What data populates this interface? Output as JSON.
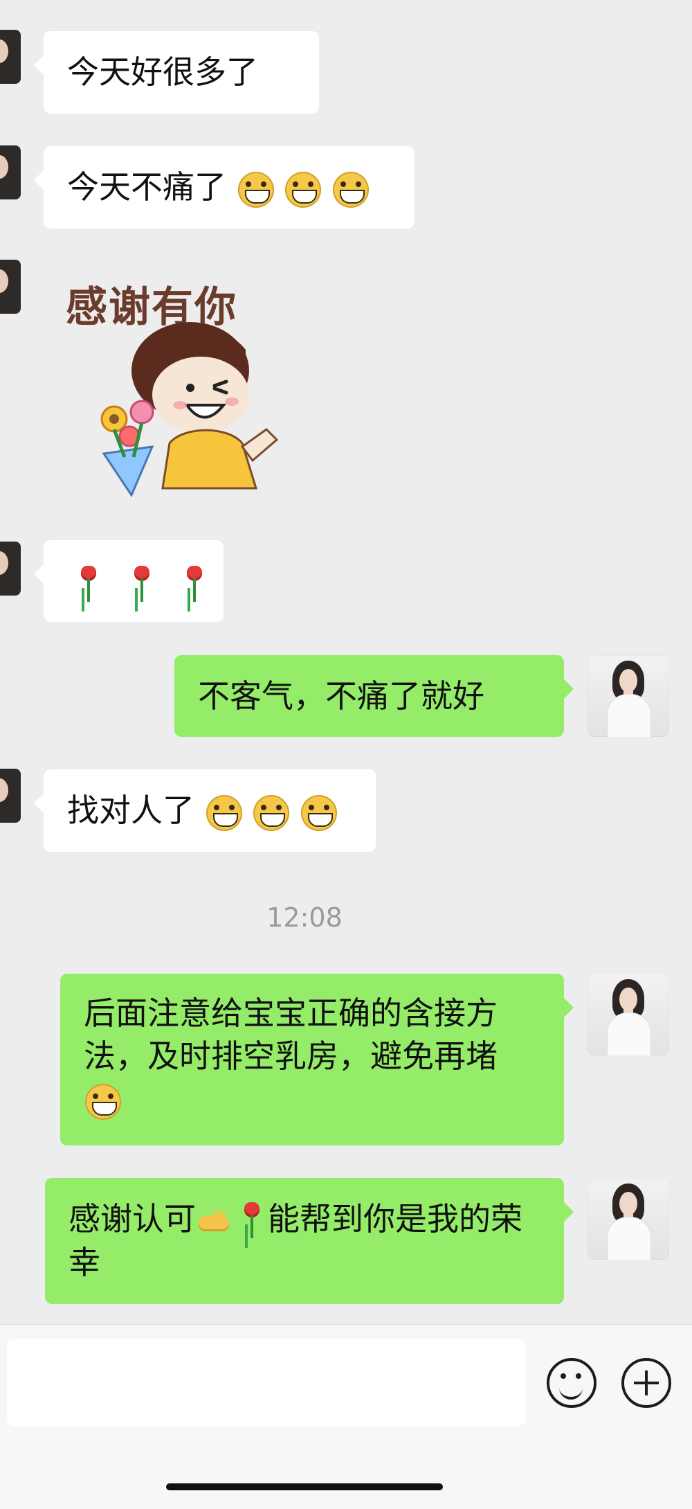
{
  "messages": [
    {
      "side": "in",
      "text": "今天好很多了",
      "suffix": []
    },
    {
      "side": "in",
      "text": "今天不痛了",
      "suffix": [
        "grinning-emoji",
        "grinning-emoji",
        "grinning-emoji"
      ]
    },
    {
      "side": "in",
      "sticker_text": "感谢有你"
    },
    {
      "side": "in",
      "emojis": [
        "rose",
        "rose",
        "rose"
      ]
    },
    {
      "side": "out",
      "text": "不客气，不痛了就好"
    },
    {
      "side": "in",
      "text": "找对人了",
      "suffix": [
        "grinning-emoji",
        "grinning-emoji",
        "grinning-emoji"
      ]
    },
    {
      "timestamp": "12:08"
    },
    {
      "side": "out",
      "text": "后面注意给宝宝正确的含接方法，及时排空乳房，避免再堵",
      "suffix": [
        "grinning-emoji"
      ]
    },
    {
      "side": "out",
      "parts": [
        "感谢认可",
        "ok-hand-emoji",
        "rose",
        "能帮到你是我的荣幸"
      ]
    }
  ],
  "labels": {
    "m1": "今天好很多了",
    "m2": "今天不痛了",
    "sticker": "感谢有你",
    "m5": "不客气，不痛了就好",
    "m6": "找对人了",
    "time": "12:08",
    "m8": "后面注意给宝宝正确的含接方法，及时排空乳房，避免再堵",
    "m9a": "感谢认可",
    "m9b": "能帮到你是我的荣幸"
  },
  "colors": {
    "background": "#ededed",
    "incoming_bubble": "#ffffff",
    "outgoing_bubble": "#95ec69"
  },
  "input_bar": {
    "input_value": "",
    "icons": [
      "emoji-icon",
      "plus-icon"
    ]
  }
}
